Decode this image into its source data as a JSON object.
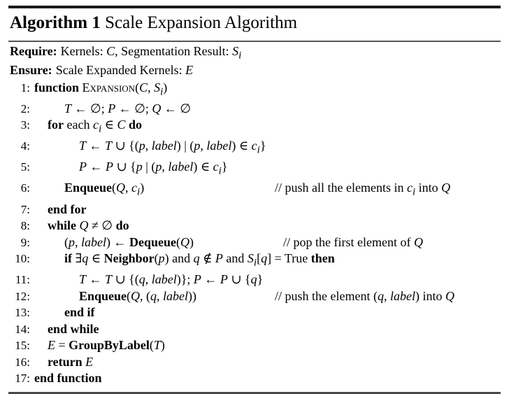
{
  "caption": {
    "label": "Algorithm 1",
    "title": "Scale Expansion Algorithm"
  },
  "io": {
    "require_label": "Require:",
    "require_text": "Kernels: C, Segmentation Result: Sᵢ",
    "ensure_label": "Ensure:",
    "ensure_text": "Scale Expanded Kernels: E"
  },
  "lines": [
    {
      "no": "1:",
      "kw": "function",
      "code": "Expansion(C, Sᵢ)",
      "comment": ""
    },
    {
      "no": "2:",
      "kw": "",
      "code": "T ← ∅; P ← ∅; Q ← ∅",
      "comment": ""
    },
    {
      "no": "3:",
      "kw": "for",
      "code": "each cᵢ ∈ C do",
      "comment": ""
    },
    {
      "no": "4:",
      "kw": "",
      "code": "T ← T ∪ {(p, label) | (p, label) ∈ cᵢ}",
      "comment": ""
    },
    {
      "no": "5:",
      "kw": "",
      "code": "P ← P ∪ {p | (p, label) ∈ cᵢ}",
      "comment": ""
    },
    {
      "no": "6:",
      "kw": "Enqueue",
      "code": "Enqueue(Q, cᵢ)",
      "comment": "// push all the elements in cᵢ into Q"
    },
    {
      "no": "7:",
      "kw": "end for",
      "code": "end for",
      "comment": ""
    },
    {
      "no": "8:",
      "kw": "while",
      "code": "while Q ≠ ∅ do",
      "comment": ""
    },
    {
      "no": "9:",
      "kw": "Dequeue",
      "code": "(p, label) ← Dequeue(Q)",
      "comment": "// pop the first element of Q"
    },
    {
      "no": "10:",
      "kw": "if",
      "code": "if ∃q ∈ Neighbor(p) and q ∉ P and Sᵢ[q] = True then",
      "comment": ""
    },
    {
      "no": "11:",
      "kw": "",
      "code": "T ← T ∪ {(q, label)}; P ← P ∪ {q}",
      "comment": ""
    },
    {
      "no": "12:",
      "kw": "Enqueue",
      "code": "Enqueue(Q, (q, label))",
      "comment": "// push the element (q, label) into Q"
    },
    {
      "no": "13:",
      "kw": "end if",
      "code": "end if",
      "comment": ""
    },
    {
      "no": "14:",
      "kw": "end while",
      "code": "end while",
      "comment": ""
    },
    {
      "no": "15:",
      "kw": "GroupByLabel",
      "code": "E = GroupByLabel(T)",
      "comment": ""
    },
    {
      "no": "16:",
      "kw": "return",
      "code": "return E",
      "comment": ""
    },
    {
      "no": "17:",
      "kw": "end function",
      "code": "end function",
      "comment": ""
    }
  ],
  "colors": {
    "text": "#000000",
    "rule_top": "#1a1a1a",
    "rule_mid": "#555555",
    "rule_bottom": "#4a4a4a",
    "background": "#ffffff"
  }
}
